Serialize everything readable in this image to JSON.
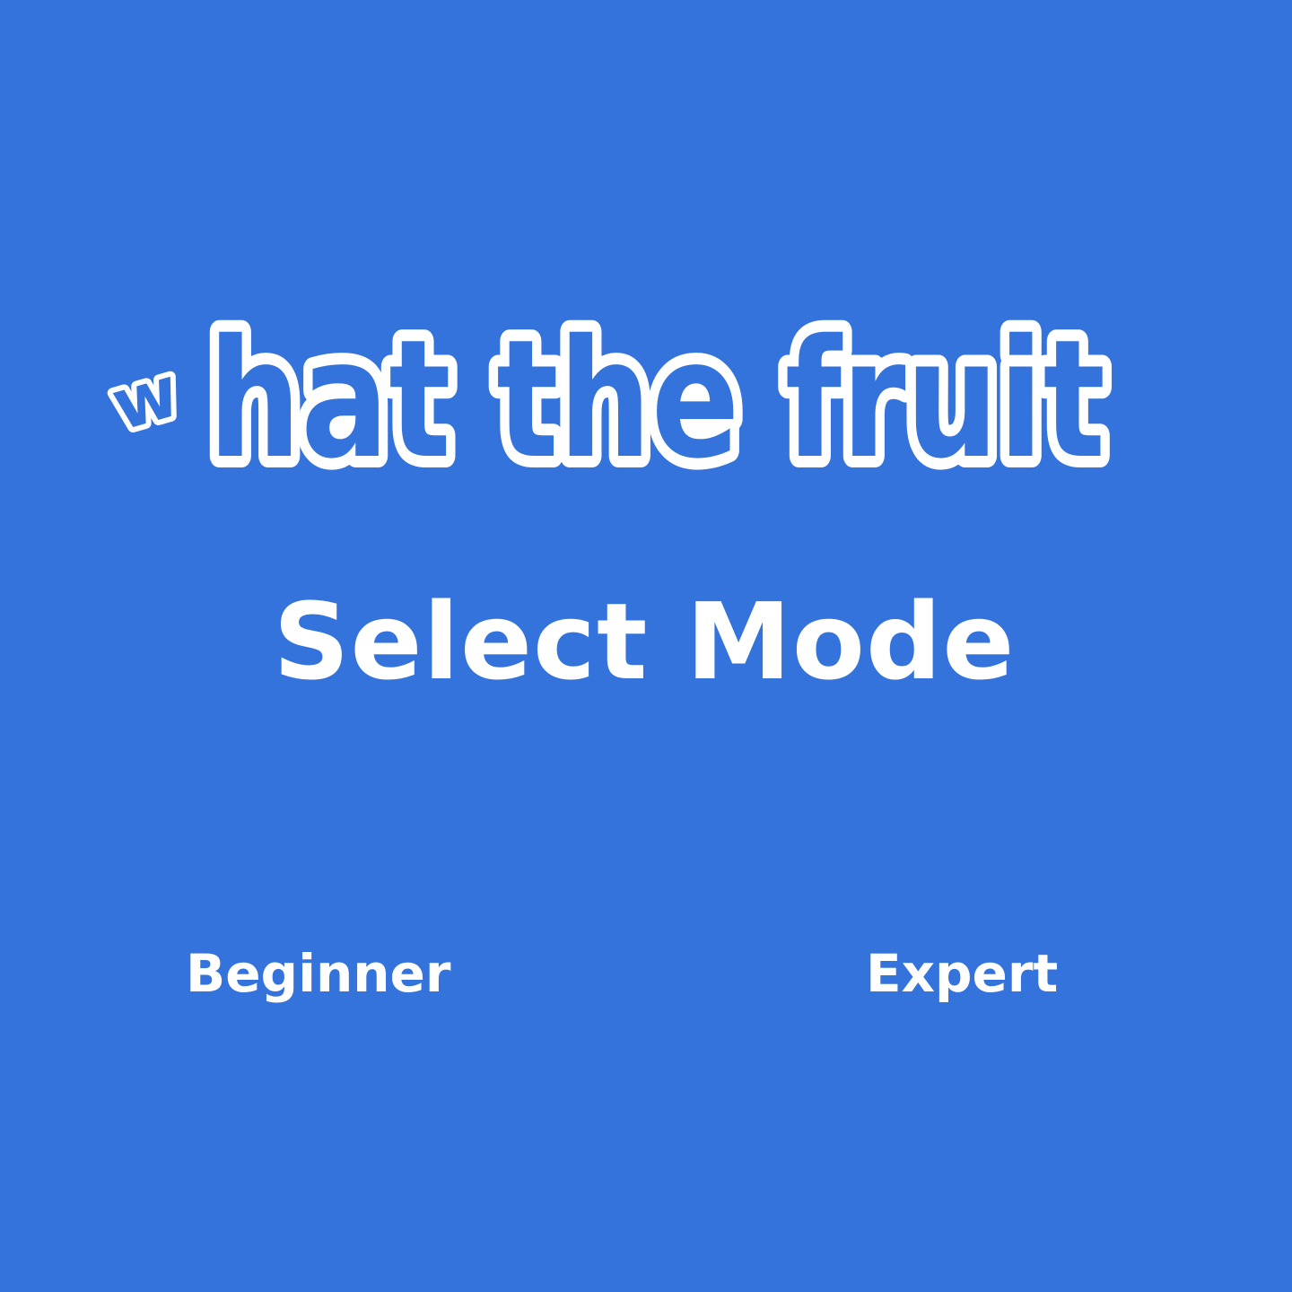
{
  "logo": {
    "first_letter": "w",
    "rest": "hat the fruit"
  },
  "screen": {
    "title": "Select Mode"
  },
  "modes": [
    {
      "label": "Beginner"
    },
    {
      "label": "Expert"
    }
  ],
  "colors": {
    "background": "#3473db",
    "text": "#ffffff"
  }
}
